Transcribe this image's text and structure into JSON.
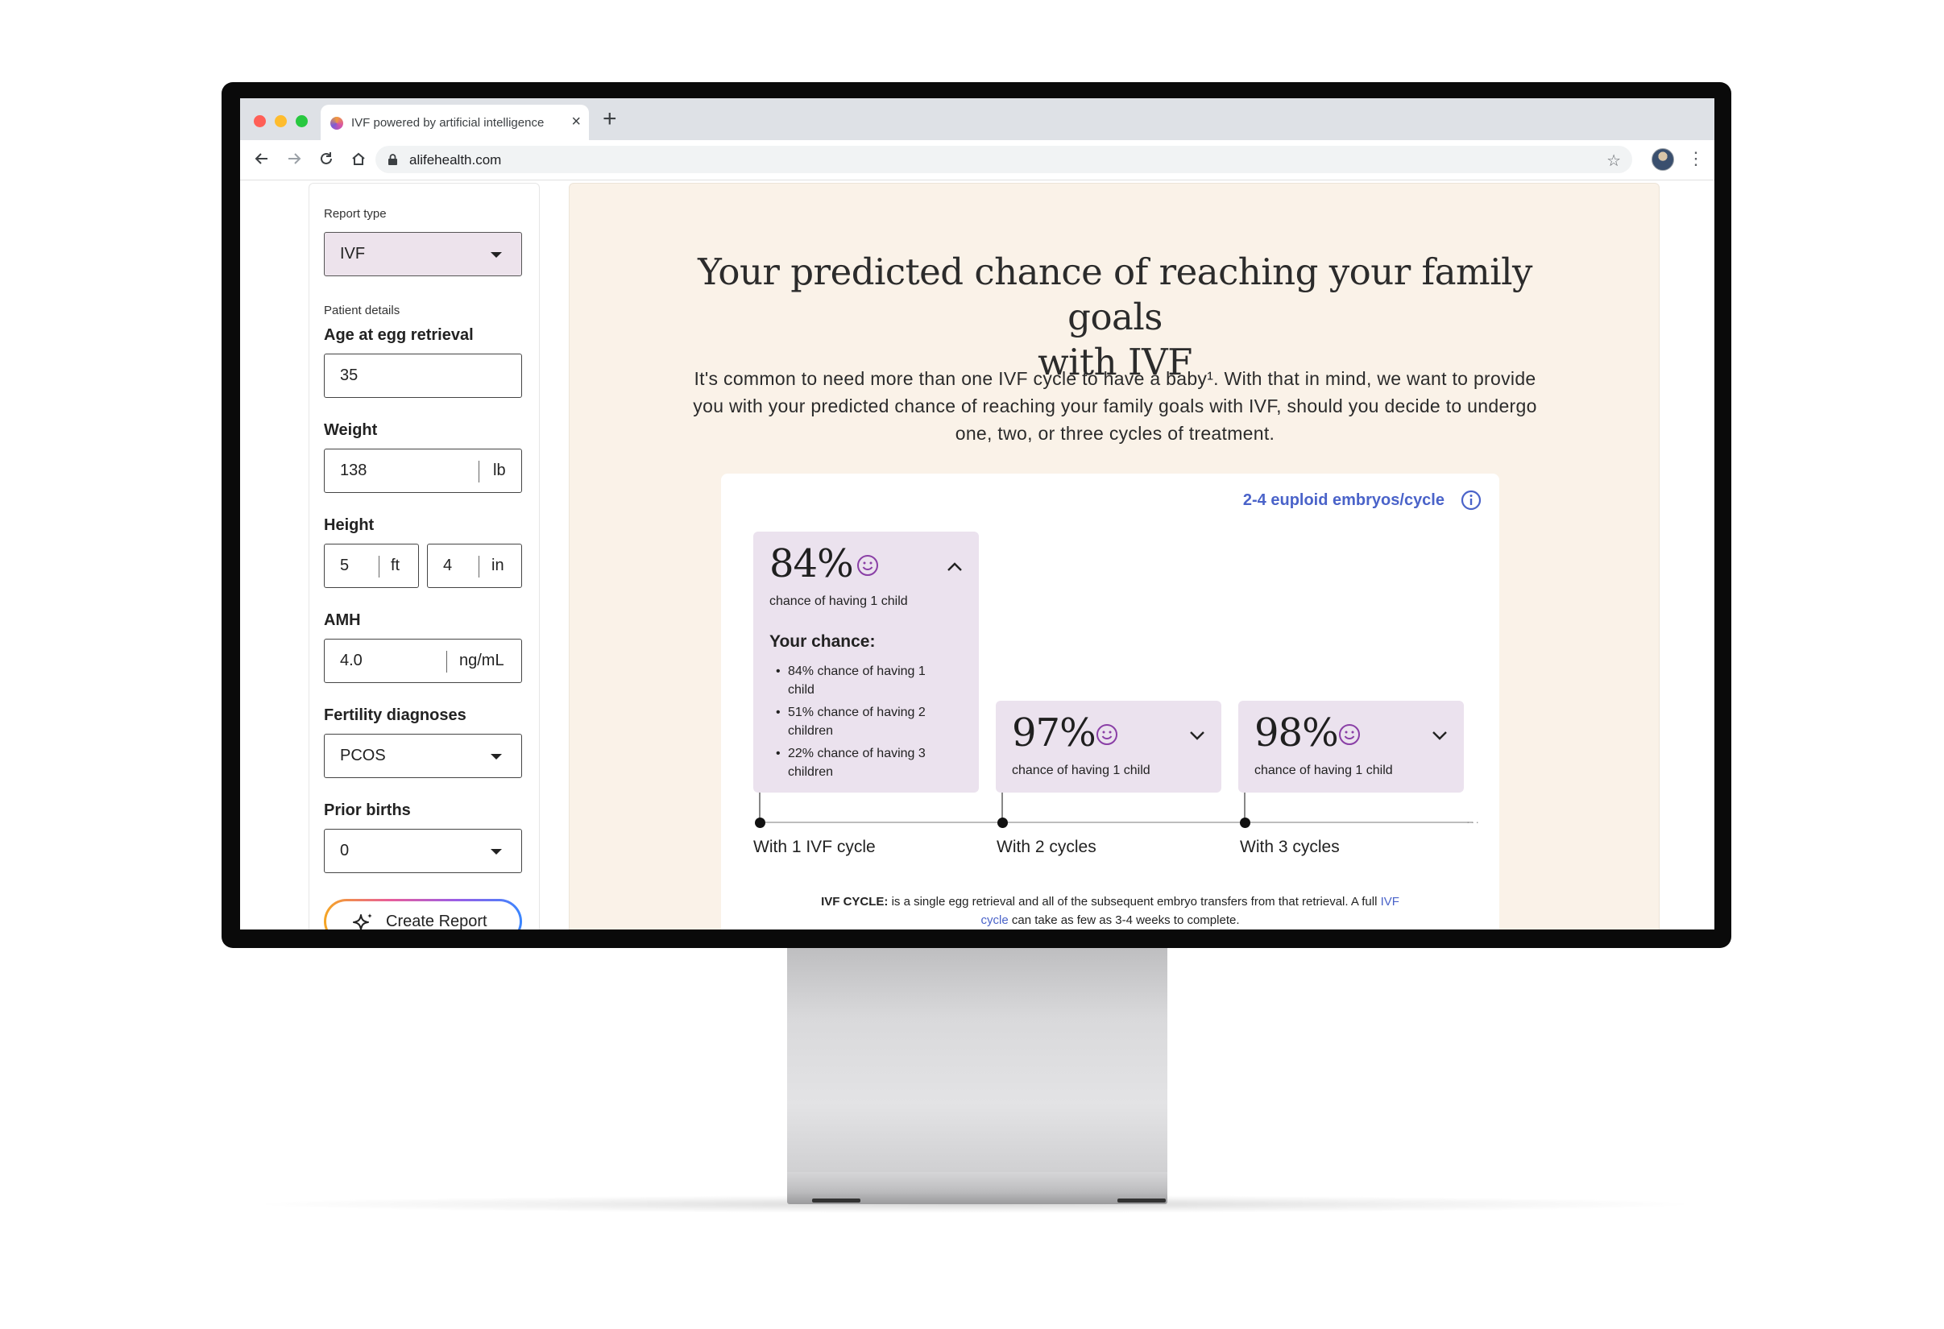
{
  "browser": {
    "tab_title": "IVF powered by artificial intelligence",
    "url": "alifehealth.com"
  },
  "sidebar": {
    "report_type_label": "Report type",
    "report_type_value": "IVF",
    "patient_details_label": "Patient details",
    "age_label": "Age at egg retrieval",
    "age_value": "35",
    "weight_label": "Weight",
    "weight_value": "138",
    "weight_unit": "lb",
    "height_label": "Height",
    "height_ft_value": "5",
    "height_ft_unit": "ft",
    "height_in_value": "4",
    "height_in_unit": "in",
    "amh_label": "AMH",
    "amh_value": "4.0",
    "amh_unit": "ng/mL",
    "diagnoses_label": "Fertility diagnoses",
    "diagnoses_value": "PCOS",
    "prior_births_label": "Prior births",
    "prior_births_value": "0",
    "create_report_label": "Create Report"
  },
  "main": {
    "headline_line1": "Your predicted chance of reaching your family goals",
    "headline_line2": "with IVF",
    "intro": "It's common to need more than one IVF cycle to have a baby¹. With that in mind, we want to provide you with your predicted chance of reaching your family goals with IVF, should you decide to undergo one, two, or three cycles of treatment.",
    "embryo_link": "2-4 euploid embryos/cycle",
    "results": [
      {
        "percent": "84%",
        "caption": "chance of having 1 child",
        "expanded": true,
        "your_chance_title": "Your chance:",
        "details": [
          "84% chance of having 1 child",
          "51% chance of having 2 children",
          "22% chance of having 3 children"
        ],
        "cycle_label": "With 1 IVF cycle"
      },
      {
        "percent": "97%",
        "caption": "chance of having 1 child",
        "expanded": false,
        "cycle_label": "With 2 cycles"
      },
      {
        "percent": "98%",
        "caption": "chance of having 1 child",
        "expanded": false,
        "cycle_label": "With 3 cycles"
      }
    ],
    "footnote_bold": "IVF CYCLE:",
    "footnote_text_1": " is a single egg retrieval and all of the subsequent embryo transfers from that retrieval. A full ",
    "footnote_link_1": "IVF",
    "footnote_link_2": "cycle",
    "footnote_text_2": " can take as few as 3-4 weeks to complete."
  },
  "colors": {
    "accent_blue": "#4a63c9",
    "result_box": "#ebe2ee",
    "panel_cream": "#faf2e8",
    "smile_purple": "#8a3fa6"
  },
  "icons": [
    "lock-icon",
    "star-icon",
    "back-icon",
    "forward-icon",
    "reload-icon",
    "home-icon",
    "info-icon",
    "smile-icon",
    "chevron-up-icon",
    "chevron-down-icon",
    "sparkle-icon",
    "caret-down-icon"
  ]
}
